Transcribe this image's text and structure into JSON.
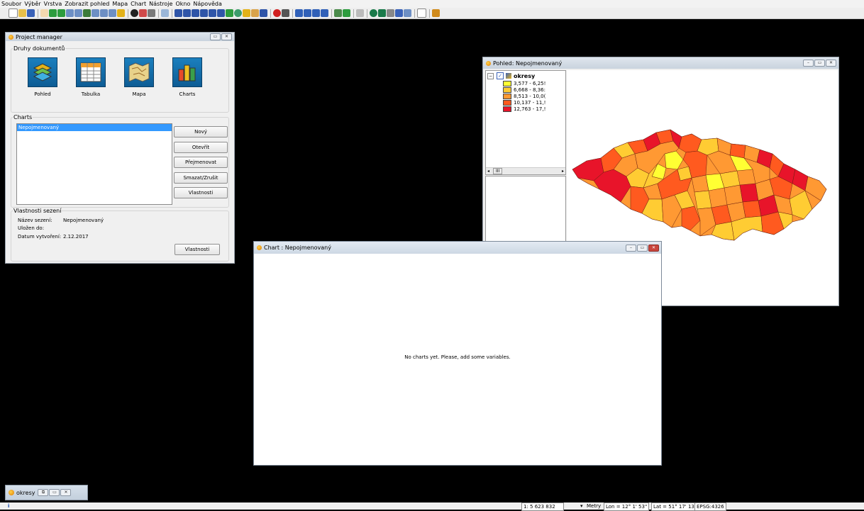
{
  "menu": [
    "Soubor",
    "Výběr",
    "Vrstva",
    "Zobrazit pohled",
    "Mapa",
    "Chart",
    "Nástroje",
    "Okno",
    "Nápověda"
  ],
  "project_manager": {
    "title": "Project manager",
    "doc_types_label": "Druhy dokumentů",
    "doc_types": [
      "Pohled",
      "Tabulka",
      "Mapa",
      "Charts"
    ],
    "charts_label": "Charts",
    "charts_list": [
      "Nepojmenovaný"
    ],
    "buttons": {
      "new": "Nový",
      "open": "Otevřít",
      "rename": "Přejmenovat",
      "delete": "Smazat/Zrušit",
      "properties": "Vlastnosti"
    },
    "session": {
      "label": "Vlastnosti sezení",
      "name_label": "Název sezení:",
      "name_value": "Nepojmenovaný",
      "saved_label": "Uložen do:",
      "saved_value": "",
      "created_label": "Datum vytvoření:",
      "created_value": "2.12.2017",
      "properties_button": "Vlastnosti"
    }
  },
  "view_window": {
    "title": "Pohled: Nepojmenovaný",
    "layer_name": "okresy",
    "legend": [
      {
        "label": "3,577 - 6,25!",
        "color": "#ffff33"
      },
      {
        "label": "6,668 - 8,36:",
        "color": "#ffcc33"
      },
      {
        "label": "8,513 - 10,0(",
        "color": "#ff9933"
      },
      {
        "label": "10,137 - 11,!",
        "color": "#ff5a1f"
      },
      {
        "label": "12,763 - 17,!",
        "color": "#e8142a"
      }
    ],
    "scroll_glyph": "III"
  },
  "chart_window": {
    "title": "Chart : Nepojmenovaný",
    "message": "No charts yet. Please, add some variables."
  },
  "minimized": {
    "label": "okresy"
  },
  "status": {
    "scale": "1: 5 623 832",
    "units": "Metry",
    "lon": "Lon = 12° 1' 53\"",
    "lat": "Lat = 51° 17' 13\"",
    "crs": "EPSG:4326"
  }
}
